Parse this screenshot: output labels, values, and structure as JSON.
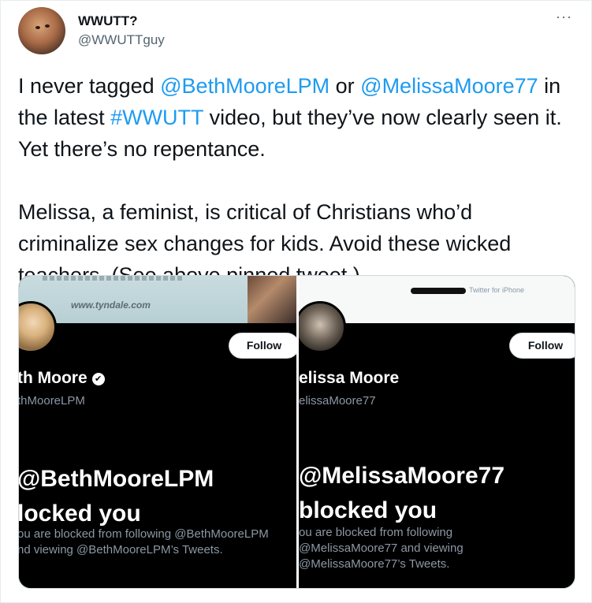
{
  "tweet": {
    "author_name": "WWUTT?",
    "author_handle": "@WWUTTguy",
    "more_icon": "···",
    "p1": {
      "t1": "I never tagged ",
      "mention1": "@BethMooreLPM",
      "t2": " or ",
      "mention2": "@MelissaMoore77",
      "t3": " in the latest ",
      "hashtag": "#WWUTT",
      "t4": " video, but they’ve now clearly seen it. Yet there’s no repentance."
    },
    "p2": "Melissa, a feminist, is critical of Christians who’d criminalize sex changes for kids. Avoid these wicked teachers. (See above pinned tweet.)"
  },
  "screenshot_left": {
    "banner_url": "www.tyndale.com",
    "follow_label": "Follow",
    "display_name": "th Moore",
    "verified_icon": "✔",
    "handle": "thMooreLPM",
    "blocked_line1": "@BethMooreLPM",
    "blocked_line2": "locked you",
    "desc_line1": "ou are blocked from following @BethMooreLPM",
    "desc_line2": "nd viewing @BethMooreLPM’s Tweets."
  },
  "screenshot_right": {
    "twitter_for": "Twitter for iPhone",
    "follow_label": "Follow",
    "display_name": "elissa Moore",
    "handle": "elissaMoore77",
    "blocked_line1": "@MelissaMoore77",
    "blocked_line2": "blocked you",
    "desc_line1": "ou are blocked from following",
    "desc_line2": "@MelissaMoore77 and viewing",
    "desc_line3": "@MelissaMoore77’s Tweets."
  },
  "colors": {
    "link": "#1d9bf0",
    "text": "#0f1419",
    "secondary": "#536471"
  }
}
